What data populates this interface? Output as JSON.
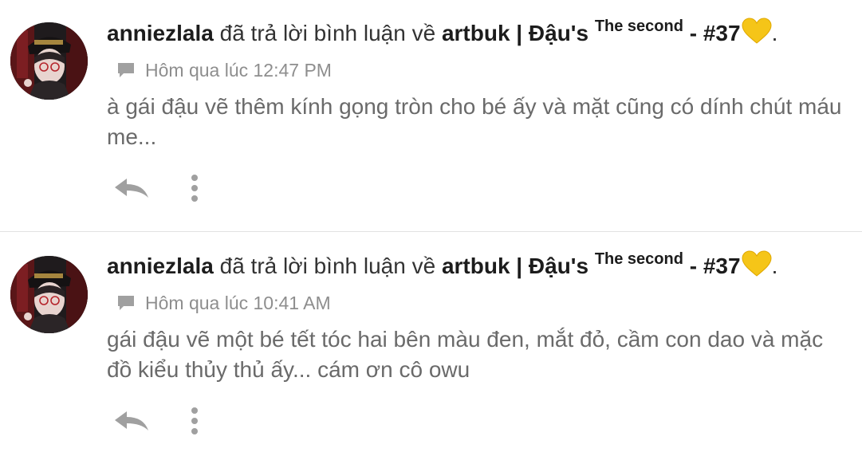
{
  "notifications": [
    {
      "user": "anniezlala",
      "action": "đã trả lời bình luận về",
      "book_title": "artbuk | Đậu's",
      "book_superscript": "The second",
      "book_suffix": "- #37",
      "emoji": "yellow-heart",
      "trailing": ".",
      "timestamp": "Hôm qua lúc 12:47 PM",
      "comment": "à gái đậu vẽ thêm kính gọng tròn cho bé ấy và mặt cũng có dính chút máu me..."
    },
    {
      "user": "anniezlala",
      "action": "đã trả lời bình luận về",
      "book_title": "artbuk | Đậu's",
      "book_superscript": "The second",
      "book_suffix": "- #37",
      "emoji": "yellow-heart",
      "trailing": ".",
      "timestamp": "Hôm qua lúc 10:41 AM",
      "comment": "gái đậu vẽ một bé tết tóc hai bên màu đen, mắt đỏ, cầm con dao và mặc đồ kiểu thủy thủ ấy... cám ơn cô owu"
    }
  ],
  "icons": {
    "comment": "speech-bubble-icon",
    "reply": "reply-arrow-icon",
    "more": "vertical-dots-icon"
  },
  "colors": {
    "heart": "#f5c518",
    "icon_gray": "#a0a0a0",
    "meta_gray": "#8e8e8e",
    "body_gray": "#6a6a6a"
  }
}
